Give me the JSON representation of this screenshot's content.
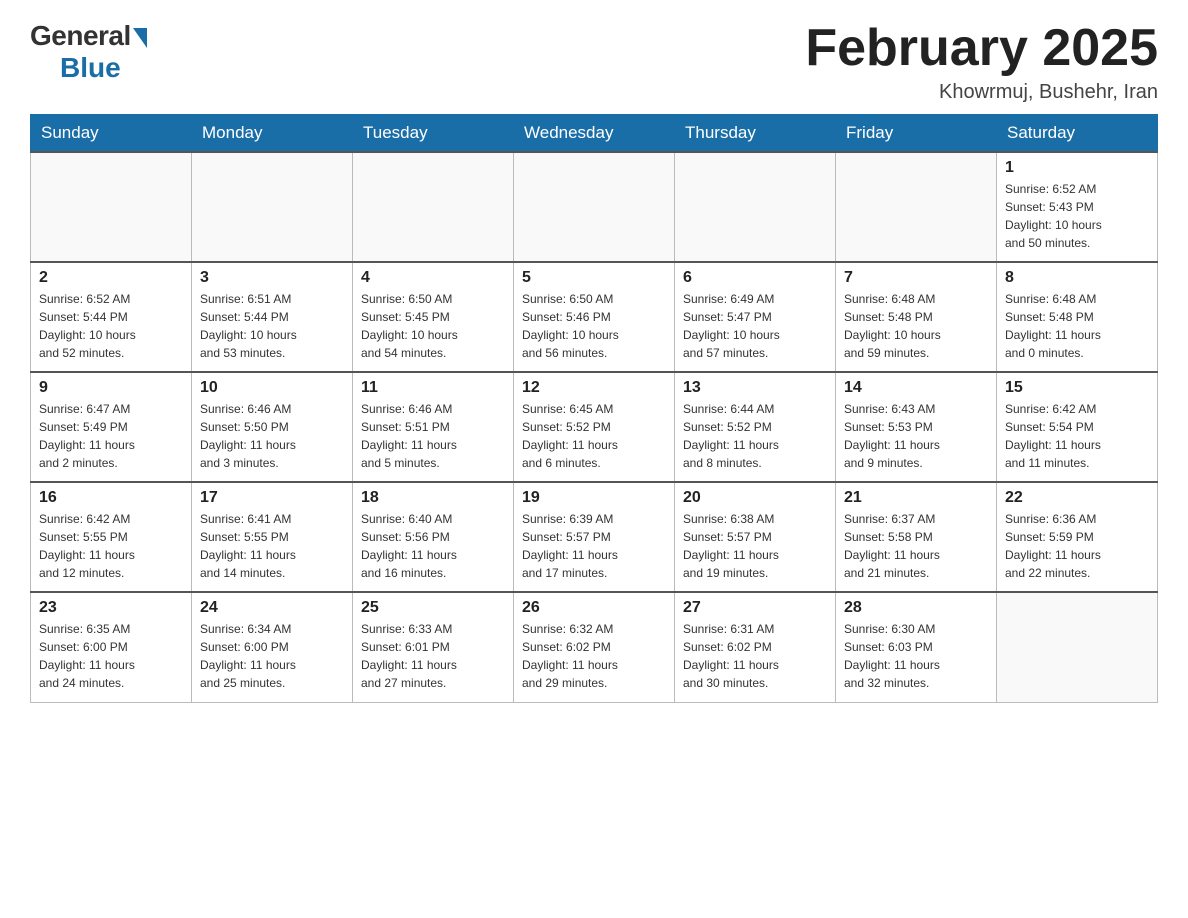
{
  "header": {
    "logo_general": "General",
    "logo_blue": "Blue",
    "month_title": "February 2025",
    "location": "Khowrmuj, Bushehr, Iran"
  },
  "weekdays": [
    "Sunday",
    "Monday",
    "Tuesday",
    "Wednesday",
    "Thursday",
    "Friday",
    "Saturday"
  ],
  "weeks": [
    {
      "days": [
        {
          "number": "",
          "info": ""
        },
        {
          "number": "",
          "info": ""
        },
        {
          "number": "",
          "info": ""
        },
        {
          "number": "",
          "info": ""
        },
        {
          "number": "",
          "info": ""
        },
        {
          "number": "",
          "info": ""
        },
        {
          "number": "1",
          "info": "Sunrise: 6:52 AM\nSunset: 5:43 PM\nDaylight: 10 hours\nand 50 minutes."
        }
      ]
    },
    {
      "days": [
        {
          "number": "2",
          "info": "Sunrise: 6:52 AM\nSunset: 5:44 PM\nDaylight: 10 hours\nand 52 minutes."
        },
        {
          "number": "3",
          "info": "Sunrise: 6:51 AM\nSunset: 5:44 PM\nDaylight: 10 hours\nand 53 minutes."
        },
        {
          "number": "4",
          "info": "Sunrise: 6:50 AM\nSunset: 5:45 PM\nDaylight: 10 hours\nand 54 minutes."
        },
        {
          "number": "5",
          "info": "Sunrise: 6:50 AM\nSunset: 5:46 PM\nDaylight: 10 hours\nand 56 minutes."
        },
        {
          "number": "6",
          "info": "Sunrise: 6:49 AM\nSunset: 5:47 PM\nDaylight: 10 hours\nand 57 minutes."
        },
        {
          "number": "7",
          "info": "Sunrise: 6:48 AM\nSunset: 5:48 PM\nDaylight: 10 hours\nand 59 minutes."
        },
        {
          "number": "8",
          "info": "Sunrise: 6:48 AM\nSunset: 5:48 PM\nDaylight: 11 hours\nand 0 minutes."
        }
      ]
    },
    {
      "days": [
        {
          "number": "9",
          "info": "Sunrise: 6:47 AM\nSunset: 5:49 PM\nDaylight: 11 hours\nand 2 minutes."
        },
        {
          "number": "10",
          "info": "Sunrise: 6:46 AM\nSunset: 5:50 PM\nDaylight: 11 hours\nand 3 minutes."
        },
        {
          "number": "11",
          "info": "Sunrise: 6:46 AM\nSunset: 5:51 PM\nDaylight: 11 hours\nand 5 minutes."
        },
        {
          "number": "12",
          "info": "Sunrise: 6:45 AM\nSunset: 5:52 PM\nDaylight: 11 hours\nand 6 minutes."
        },
        {
          "number": "13",
          "info": "Sunrise: 6:44 AM\nSunset: 5:52 PM\nDaylight: 11 hours\nand 8 minutes."
        },
        {
          "number": "14",
          "info": "Sunrise: 6:43 AM\nSunset: 5:53 PM\nDaylight: 11 hours\nand 9 minutes."
        },
        {
          "number": "15",
          "info": "Sunrise: 6:42 AM\nSunset: 5:54 PM\nDaylight: 11 hours\nand 11 minutes."
        }
      ]
    },
    {
      "days": [
        {
          "number": "16",
          "info": "Sunrise: 6:42 AM\nSunset: 5:55 PM\nDaylight: 11 hours\nand 12 minutes."
        },
        {
          "number": "17",
          "info": "Sunrise: 6:41 AM\nSunset: 5:55 PM\nDaylight: 11 hours\nand 14 minutes."
        },
        {
          "number": "18",
          "info": "Sunrise: 6:40 AM\nSunset: 5:56 PM\nDaylight: 11 hours\nand 16 minutes."
        },
        {
          "number": "19",
          "info": "Sunrise: 6:39 AM\nSunset: 5:57 PM\nDaylight: 11 hours\nand 17 minutes."
        },
        {
          "number": "20",
          "info": "Sunrise: 6:38 AM\nSunset: 5:57 PM\nDaylight: 11 hours\nand 19 minutes."
        },
        {
          "number": "21",
          "info": "Sunrise: 6:37 AM\nSunset: 5:58 PM\nDaylight: 11 hours\nand 21 minutes."
        },
        {
          "number": "22",
          "info": "Sunrise: 6:36 AM\nSunset: 5:59 PM\nDaylight: 11 hours\nand 22 minutes."
        }
      ]
    },
    {
      "days": [
        {
          "number": "23",
          "info": "Sunrise: 6:35 AM\nSunset: 6:00 PM\nDaylight: 11 hours\nand 24 minutes."
        },
        {
          "number": "24",
          "info": "Sunrise: 6:34 AM\nSunset: 6:00 PM\nDaylight: 11 hours\nand 25 minutes."
        },
        {
          "number": "25",
          "info": "Sunrise: 6:33 AM\nSunset: 6:01 PM\nDaylight: 11 hours\nand 27 minutes."
        },
        {
          "number": "26",
          "info": "Sunrise: 6:32 AM\nSunset: 6:02 PM\nDaylight: 11 hours\nand 29 minutes."
        },
        {
          "number": "27",
          "info": "Sunrise: 6:31 AM\nSunset: 6:02 PM\nDaylight: 11 hours\nand 30 minutes."
        },
        {
          "number": "28",
          "info": "Sunrise: 6:30 AM\nSunset: 6:03 PM\nDaylight: 11 hours\nand 32 minutes."
        },
        {
          "number": "",
          "info": ""
        }
      ]
    }
  ]
}
